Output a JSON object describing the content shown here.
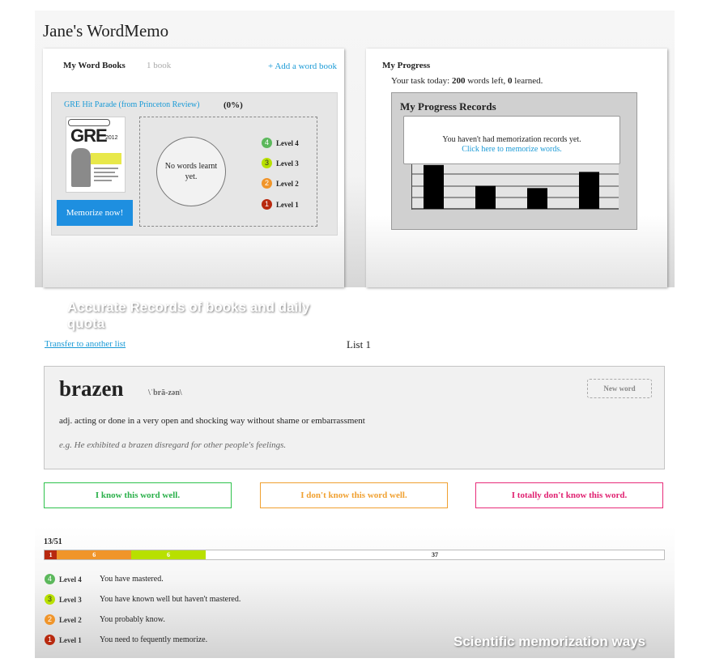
{
  "app": {
    "title": "Jane's WordMemo"
  },
  "word_books": {
    "title": "My Word Books",
    "count": "1 book",
    "add_link": "+ Add a word book",
    "book": {
      "name": "GRE Hit Parade (from Princeton Review)",
      "percent": "(0%)",
      "cover": {
        "brand": "GRE",
        "year": "2012"
      },
      "memorize_button": "Memorize now!",
      "empty_text": "No words learnt yet.",
      "levels": [
        {
          "num": "4",
          "label": "Level 4",
          "color": "#5cb85c"
        },
        {
          "num": "3",
          "label": "Level 3",
          "color": "#b8e000"
        },
        {
          "num": "2",
          "label": "Level 2",
          "color": "#f0952a"
        },
        {
          "num": "1",
          "label": "Level 1",
          "color": "#b8290f"
        }
      ]
    },
    "caption": "Accurate Records of books and daily quota"
  },
  "progress": {
    "title": "My Progress",
    "task_prefix": "Your task today:",
    "words_left": "200",
    "words_left_suffix": "words left,",
    "learned": "0",
    "learned_suffix": "learned.",
    "records_title": "My Progress Records",
    "no_records_msg": "You haven't had memorization records yet.",
    "memorize_link": "Click here to memorize words.",
    "placeholder_bar_levels": [
      0.95,
      0.5,
      0.45,
      0.8
    ]
  },
  "list": {
    "transfer_link": "Transfer to another list",
    "name": "List 1"
  },
  "word_card": {
    "word": "brazen",
    "pronunciation": "\\ˈbrā-zən\\",
    "new_word_button": "New word",
    "definition": "adj. acting or done in a very open and shocking way without shame or embarrassment",
    "example": "e.g. He exhibited a brazen disregard for other people's feelings."
  },
  "choices": {
    "know": "I know this word well.",
    "dont_know": "I don't know this word well.",
    "totally_dont": "I totally don't know this word."
  },
  "stats": {
    "count": "13/51",
    "segments": [
      {
        "value": 1,
        "label": "1",
        "color": "#b8290f"
      },
      {
        "value": 6,
        "label": "6",
        "color": "#f0952a"
      },
      {
        "value": 6,
        "label": "6",
        "color": "#b8e000"
      },
      {
        "value": 37,
        "label": "37",
        "color": "#ffffff"
      }
    ],
    "legend": [
      {
        "num": "4",
        "level": "Level 4",
        "desc": "You have mastered.",
        "color": "#5cb85c"
      },
      {
        "num": "3",
        "level": "Level 3",
        "desc": "You have known well but haven't mastered.",
        "color": "#b8e000"
      },
      {
        "num": "2",
        "level": "Level 2",
        "desc": "You probably know.",
        "color": "#f0952a"
      },
      {
        "num": "1",
        "level": "Level 1",
        "desc": "You need to fequently memorize.",
        "color": "#b8290f"
      }
    ],
    "caption": "Scientific memorization ways"
  }
}
